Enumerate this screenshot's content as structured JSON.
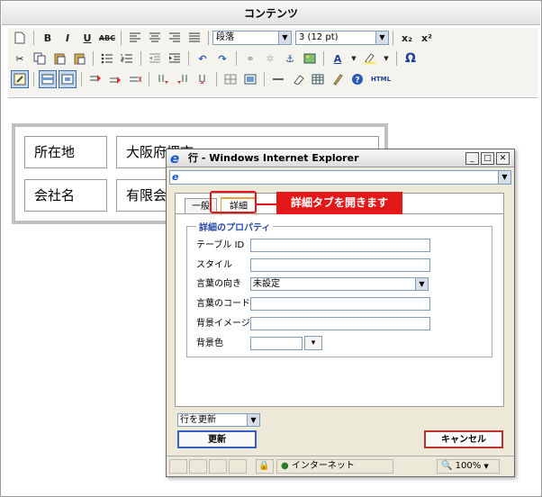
{
  "window": {
    "title": "コンテンツ"
  },
  "toolbar": {
    "format_select": "段落",
    "size_select": "3 (12 pt)",
    "bold_label": "B",
    "italic_label": "I",
    "underline_label": "U",
    "strike_label": "ABC",
    "subscript_label": "x₂",
    "superscript_label": "x²",
    "omega_label": "Ω",
    "font_color_label": "A",
    "html_label": "HTML"
  },
  "table": {
    "rows": [
      [
        "所在地",
        "大阪府堺市"
      ],
      [
        "会社名",
        "有限会社"
      ]
    ]
  },
  "popup": {
    "title": "行 - Windows Internet Explorer",
    "tabs": [
      {
        "label": "一般",
        "active": false
      },
      {
        "label": "詳細",
        "active": true
      }
    ],
    "fieldset_legend": "詳細のプロパティ",
    "fields": [
      {
        "label": "テーブル ID",
        "value": ""
      },
      {
        "label": "スタイル",
        "value": ""
      },
      {
        "label": "言葉の向き",
        "value": "未設定"
      },
      {
        "label": "言葉のコード",
        "value": ""
      },
      {
        "label": "背景イメージ",
        "value": ""
      },
      {
        "label": "背景色",
        "value": ""
      }
    ],
    "bottom_select": "行を更新",
    "update_button": "更新",
    "cancel_button": "キャンセル",
    "status_zone": "インターネット",
    "zoom": "100%"
  },
  "callout": {
    "text": "詳細タブを開きます",
    "color": "#e31919"
  }
}
